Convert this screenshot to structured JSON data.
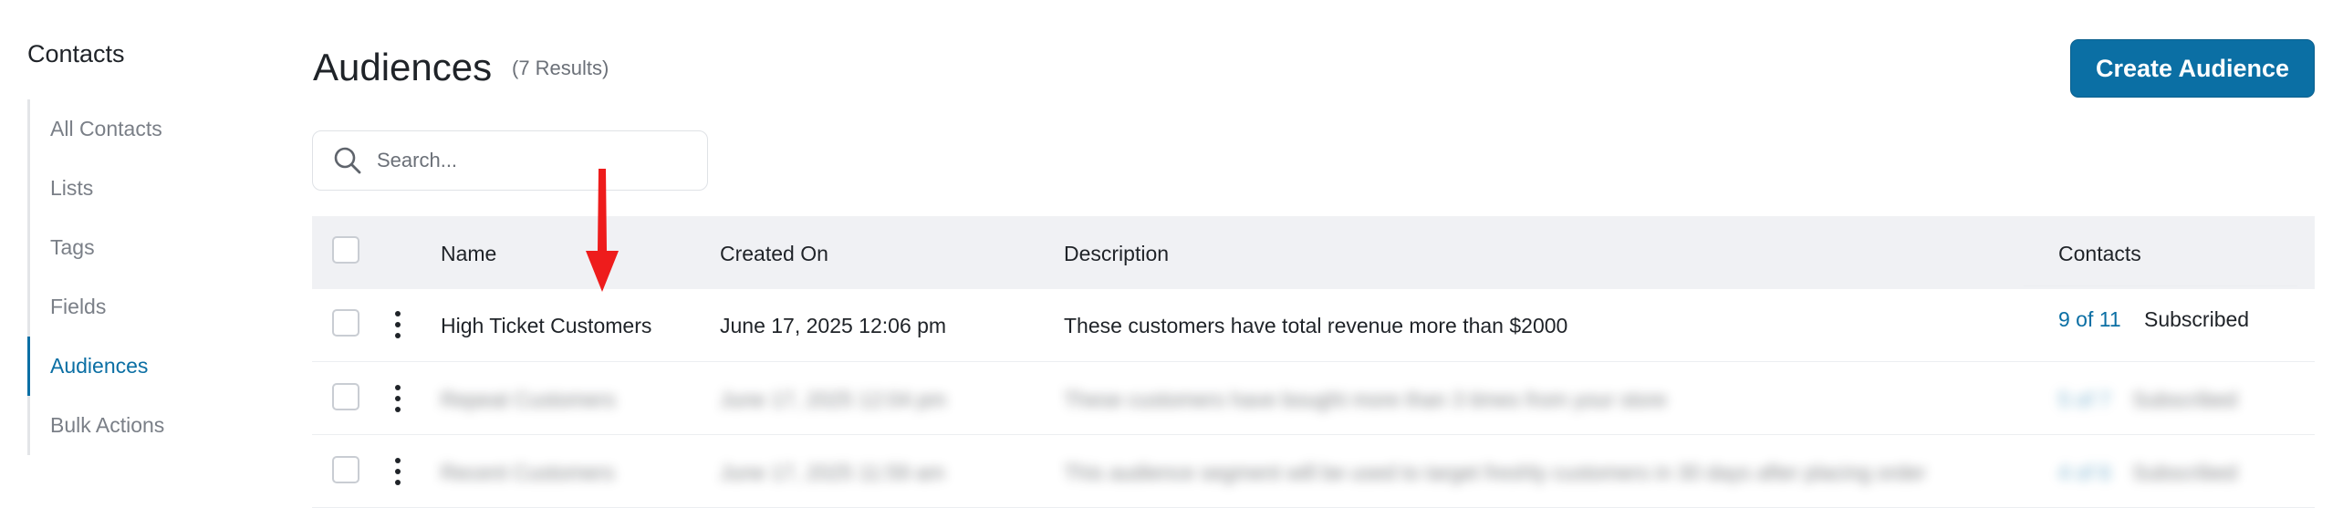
{
  "sidebar": {
    "title": "Contacts",
    "items": [
      {
        "label": "All Contacts",
        "active": false
      },
      {
        "label": "Lists",
        "active": false
      },
      {
        "label": "Tags",
        "active": false
      },
      {
        "label": "Fields",
        "active": false
      },
      {
        "label": "Audiences",
        "active": true
      },
      {
        "label": "Bulk Actions",
        "active": false
      }
    ]
  },
  "header": {
    "title": "Audiences",
    "count": "(7 Results)",
    "create_label": "Create Audience"
  },
  "search": {
    "placeholder": "Search..."
  },
  "table": {
    "columns": [
      "Name",
      "Created On",
      "Description",
      "Contacts"
    ],
    "rows": [
      {
        "name": "High Ticket Customers",
        "created_on": "June 17, 2025 12:06 pm",
        "description": "These customers have total revenue more than $2000",
        "contacts_count": "9 of 11",
        "contacts_status": "Subscribed",
        "blurred": false
      },
      {
        "name": "Repeat Customers",
        "created_on": "June 17, 2025 12:04 pm",
        "description": "These customers have bought more than 3 times from your store",
        "contacts_count": "5 of 7",
        "contacts_status": "Subscribed",
        "blurred": true
      },
      {
        "name": "Recent Customers",
        "created_on": "June 17, 2025 11:59 am",
        "description": "This audience segment will be used to target freshly customers in 30 days after placing order",
        "contacts_count": "4 of 6",
        "contacts_status": "Subscribed",
        "blurred": true
      }
    ]
  },
  "colors": {
    "accent": "#0b6fa4",
    "annotation_arrow": "#ee1c1c"
  }
}
